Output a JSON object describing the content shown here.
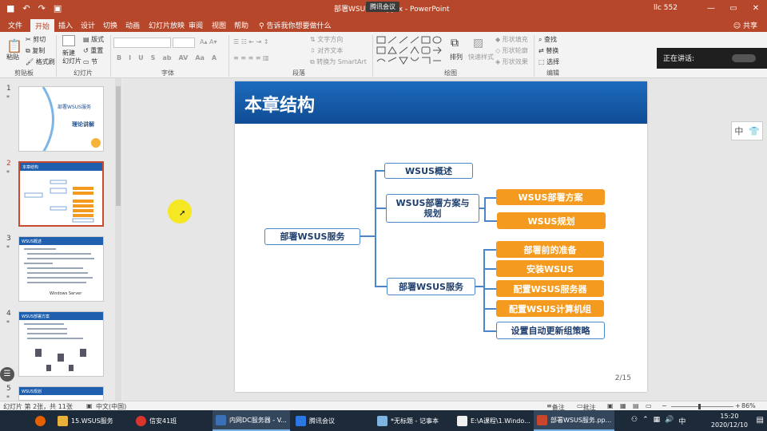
{
  "titlebar": {
    "title": "部署WSUS服务.pptx - PowerPoint",
    "meeting": "腾讯会议",
    "user": "llc 552",
    "minimize": "—",
    "restore": "▭",
    "close": "✕",
    "save_icon": "■",
    "undo_icon": "↶",
    "redo_icon": "↷",
    "present_icon": "▣"
  },
  "tabs": [
    "文件",
    "开始",
    "插入",
    "设计",
    "切换",
    "动画",
    "幻灯片放映",
    "审阅",
    "视图",
    "帮助"
  ],
  "tell_me": "告诉我你想要做什么",
  "share": "共享",
  "ribbon": {
    "paste": "粘贴",
    "cut": "剪切",
    "copy": "复制",
    "format_painter": "格式刷",
    "new_slide": "新建\n幻灯片",
    "layout": "版式",
    "reset": "重置",
    "section": "节",
    "text_direction": "文字方向",
    "align_text": "对齐文本",
    "smartart": "转换为 SmartArt",
    "arrange": "排列",
    "quick_styles": "快速样式",
    "shape_fill": "形状填充",
    "shape_outline": "形状轮廓",
    "shape_effects": "形状效果",
    "find": "查找",
    "replace": "替换",
    "select": "选择",
    "groups": {
      "clipboard": "剪贴板",
      "slides": "幻灯片",
      "font": "字体",
      "paragraph": "段落",
      "drawing": "绘图",
      "editing": "编辑"
    },
    "font_buttons": [
      "B",
      "I",
      "U",
      "S",
      "ab",
      "AV",
      "Aa",
      "A"
    ]
  },
  "speaker": {
    "label": "正在讲话:"
  },
  "thumbnails": [
    {
      "num": "1",
      "star": "*",
      "title": "部署WSUS服务",
      "subtitle": "理论讲解"
    },
    {
      "num": "2",
      "star": "*",
      "title": "本章结构"
    },
    {
      "num": "3",
      "star": "*",
      "title": "WSUS概述",
      "footer": "Windows Server"
    },
    {
      "num": "4",
      "star": "*",
      "title": "WSUS部署方案"
    },
    {
      "num": "5",
      "star": "*",
      "title": "WSUS规划"
    }
  ],
  "slide": {
    "title": "本章结构",
    "page": "2/15",
    "root": "部署WSUS服务",
    "branches": [
      {
        "label": "WSUS概述"
      },
      {
        "label": "WSUS部署方案与\n规划"
      },
      {
        "label": "部署WSUS服务"
      }
    ],
    "leaves": [
      "WSUS部署方案",
      "WSUS规划",
      "部署前的准备",
      "安装WSUS",
      "配置WSUS服务器",
      "配置WSUS计算机组",
      "设置自动更新组策略"
    ],
    "colors": {
      "header": "#1565b9",
      "accent": "#f49b1f",
      "line": "#4a86c8"
    }
  },
  "sidewidget": {
    "lang": "中",
    "shirt_icon": "shirt-icon"
  },
  "status": {
    "slide_info": "幻灯片 第 2张，共 11张",
    "language": "中文(中国)",
    "notes": "备注",
    "comments": "批注",
    "zoom": "86%"
  },
  "taskbar": {
    "items": [
      {
        "label": "15.WSUS服务",
        "color": "#e7b13b"
      },
      {
        "label": "信安41班",
        "color": "#d9352c"
      },
      {
        "label": "内网DC服务器 - V...",
        "color": "#3b6fb6"
      },
      {
        "label": "腾讯会议",
        "color": "#2b78e4"
      },
      {
        "label": "*无标题 - 记事本",
        "color": "#7fb3e0"
      },
      {
        "label": "E:\\A课程\\1.Windo...",
        "color": "#f0f0f0"
      },
      {
        "label": "部署WSUS服务.pp...",
        "color": "#c9462c"
      }
    ],
    "time": "15:20",
    "date": "2020/12/10"
  }
}
